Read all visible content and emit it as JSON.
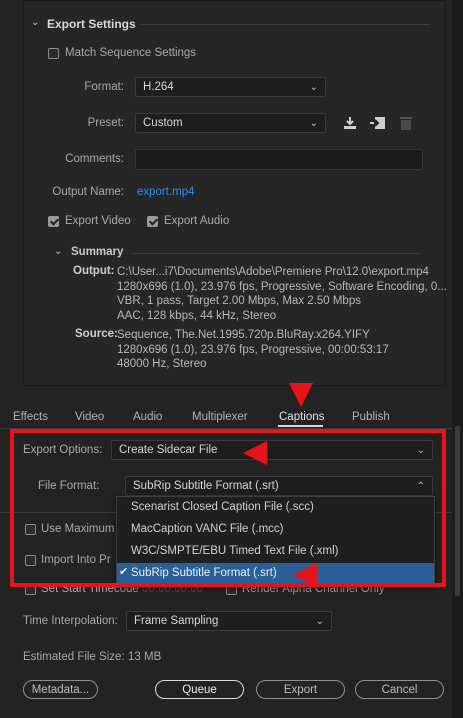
{
  "export_settings": {
    "section_title": "Export Settings",
    "match_sequence_label": "Match Sequence Settings",
    "format_label": "Format:",
    "format_value": "H.264",
    "preset_label": "Preset:",
    "preset_value": "Custom",
    "comments_label": "Comments:",
    "comments_value": "",
    "output_name_label": "Output Name:",
    "output_name_value": "export.mp4",
    "export_video_label": "Export Video",
    "export_audio_label": "Export Audio",
    "export_video_checked": true,
    "export_audio_checked": true,
    "match_sequence_checked": false
  },
  "summary": {
    "title": "Summary",
    "output_label": "Output:",
    "output_lines": [
      "C:\\User...i7\\Documents\\Adobe\\Premiere Pro\\12.0\\export.mp4",
      "1280x696 (1.0), 23.976 fps, Progressive, Software Encoding, 0...",
      "VBR, 1 pass, Target 2.00 Mbps, Max 2.50 Mbps",
      "AAC, 128 kbps, 44 kHz, Stereo"
    ],
    "source_label": "Source:",
    "source_lines": [
      "Sequence, The.Net.1995.720p.BluRay.x264.YIFY",
      "1280x696 (1.0), 23.976 fps, Progressive, 00:00:53:17",
      "48000 Hz, Stereo"
    ]
  },
  "tabs": {
    "effects": "Effects",
    "video": "Video",
    "audio": "Audio",
    "multiplexer": "Multiplexer",
    "captions": "Captions",
    "publish": "Publish",
    "active": "Captions"
  },
  "captions": {
    "export_options_label": "Export Options:",
    "export_options_value": "Create Sidecar File",
    "file_format_label": "File Format:",
    "file_format_value": "SubRip Subtitle Format (.srt)",
    "menu_items": [
      "Scenarist Closed Caption File (.scc)",
      "MacCaption VANC File (.mcc)",
      "W3C/SMPTE/EBU Timed Text File (.xml)",
      "SubRip Subtitle Format (.srt)"
    ],
    "selected_index": 3
  },
  "bottom": {
    "use_maximum_label": "Use Maximum",
    "import_into_label": "Import Into Pr",
    "set_start_timecode_label": "Set Start Timecode",
    "timecode_value": "00:00:00:00",
    "render_alpha_label": "Render Alpha Channel Only",
    "time_interp_label": "Time Interpolation:",
    "time_interp_value": "Frame Sampling",
    "est_size_label": "Estimated File Size:",
    "est_size_value": "13 MB"
  },
  "buttons": {
    "metadata": "Metadata...",
    "queue": "Queue",
    "export": "Export",
    "cancel": "Cancel"
  },
  "colors": {
    "highlight_red": "#e8121a",
    "link_blue": "#2d8ceb",
    "selected_blue": "#2a5f98"
  },
  "icons": {
    "save_preset": "download-icon",
    "import_preset": "import-preset-icon",
    "delete_preset": "trash-icon",
    "check": "checkmark-icon",
    "collapse": "chevron-down-icon"
  }
}
